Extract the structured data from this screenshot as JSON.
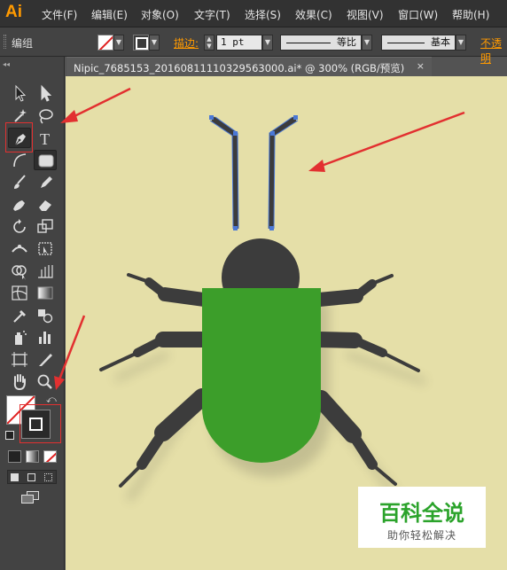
{
  "app": {
    "logo": "Ai",
    "accent": "#ff9a00"
  },
  "menu": [
    "文件(F)",
    "编辑(E)",
    "对象(O)",
    "文字(T)",
    "选择(S)",
    "效果(C)",
    "视图(V)",
    "窗口(W)",
    "帮助(H)"
  ],
  "control_bar": {
    "selection_label": "编组",
    "stroke_label": "描边:",
    "stroke_weight": "1 pt",
    "variable_width_profile": "等比",
    "brush_definition": "基本",
    "opacity_label": "不透明"
  },
  "document": {
    "tab_title": "Nipic_7685153_20160811110329563000.ai*  @  300%  (RGB/预览)",
    "close_glyph": "×"
  },
  "tools": [
    "selection-tool",
    "direct-selection-tool",
    "magic-wand-tool",
    "lasso-tool",
    "pen-tool",
    "type-tool",
    "arc-tool",
    "rounded-rectangle-tool",
    "paintbrush-tool",
    "pencil-tool",
    "blob-brush-tool",
    "eraser-tool",
    "rotate-tool",
    "scale-tool",
    "width-tool",
    "free-transform-tool",
    "shape-builder-tool",
    "perspective-grid-tool",
    "mesh-tool",
    "gradient-tool",
    "eyedropper-tool",
    "blend-tool",
    "symbol-sprayer-tool",
    "column-graph-tool",
    "artboard-tool",
    "slice-tool",
    "hand-tool",
    "zoom-tool"
  ],
  "colors": {
    "canvas": "#e5dfa8",
    "bug_body": "#3c9e2a",
    "bug_head": "#3c3c3c",
    "arrows": "#e23030",
    "path_stroke": "#4a78d6"
  },
  "watermark": {
    "title": "百科全说",
    "subtitle": "助你轻松解决"
  }
}
